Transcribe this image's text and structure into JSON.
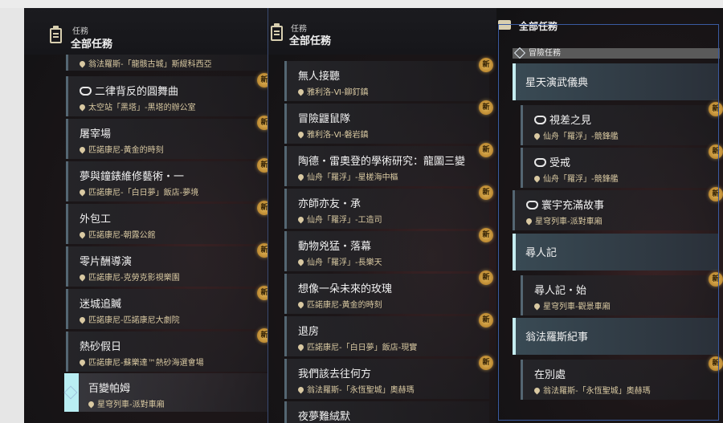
{
  "panel1": {
    "header_small": "任務",
    "header_big": "全部任務",
    "prev_location": "翁法羅斯-「龍骸古城」斯緹科西亞",
    "items": [
      {
        "title": "二律背反的圓舞曲",
        "location": "太空站「黑塔」-黑塔的辦公室",
        "special": true,
        "badge": "新"
      },
      {
        "title": "屠宰場",
        "location": "匹諾康尼-黃金的時刻",
        "special": false,
        "badge": "新"
      },
      {
        "title": "夢與鐘錶維修藝術・一",
        "location": "匹諾康尼-「白日夢」飯店-夢境",
        "special": false,
        "badge": "新"
      },
      {
        "title": "外包工",
        "location": "匹諾康尼-朝露公館",
        "special": false,
        "badge": "新"
      },
      {
        "title": "零片酬導演",
        "location": "匹諾康尼-克勞克影視樂園",
        "special": false,
        "badge": "新"
      },
      {
        "title": "迷城追贓",
        "location": "匹諾康尼-匹諾康尼大劇院",
        "special": false,
        "badge": "新"
      },
      {
        "title": "熱砂假日",
        "location": "匹諾康尼-蘇樂達™熱砂海選會場",
        "special": false,
        "badge": "新"
      }
    ],
    "selected": {
      "title": "百變帕姆",
      "location": "星穹列車-派對車廂"
    }
  },
  "panel2": {
    "header_small": "任務",
    "header_big": "全部任務",
    "items": [
      {
        "title": "無人接聽",
        "location": "雅利洛-Ⅵ-鉚釘鎮",
        "badge": "新"
      },
      {
        "title": "冒險鼴鼠隊",
        "location": "雅利洛-Ⅵ-磐岩鎮",
        "badge": "新"
      },
      {
        "title": "陶德・雷奧登的學術研究：龍圖三變",
        "location": "仙舟「羅浮」-星槎海中樞",
        "badge": "新"
      },
      {
        "title": "亦師亦友・承",
        "location": "仙舟「羅浮」-工造司",
        "badge": "新"
      },
      {
        "title": "動物兇猛・落幕",
        "location": "仙舟「羅浮」-長樂天",
        "badge": "新"
      },
      {
        "title": "想像一朵未來的玫瑰",
        "location": "匹諾康尼-黃金的時刻",
        "badge": "新"
      },
      {
        "title": "退房",
        "location": "匹諾康尼-「白日夢」飯店-現實",
        "badge": "新"
      },
      {
        "title": "我們該去往何方",
        "location": "翁法羅斯-「永恆聖城」奧赫瑪",
        "badge": "新"
      },
      {
        "title": "夜夢難絨默",
        "location": "",
        "badge": ""
      }
    ]
  },
  "panel3": {
    "header_big": "全部任務",
    "subheader": "冒險任務",
    "cat1": "星天演武儀典",
    "cat1_items": [
      {
        "title": "視差之見",
        "location": "仙舟「羅浮」-競鋒艦",
        "badge": "新"
      },
      {
        "title": "受戒",
        "location": "仙舟「羅浮」-競鋒艦",
        "badge": "新"
      }
    ],
    "loose": {
      "title": "寰宇充滿故事",
      "location": "星穹列車-派對車廂",
      "badge": "新"
    },
    "cat2": "尋人記",
    "cat2_items": [
      {
        "title": "尋人記・始",
        "location": "星穹列車-觀景車廂",
        "badge": "新"
      }
    ],
    "cat3": "翁法羅斯紀事",
    "cat3_items": [
      {
        "title": "在別處",
        "location": "翁法羅斯-「永恆聖城」奧赫瑪",
        "badge": "新"
      }
    ]
  }
}
